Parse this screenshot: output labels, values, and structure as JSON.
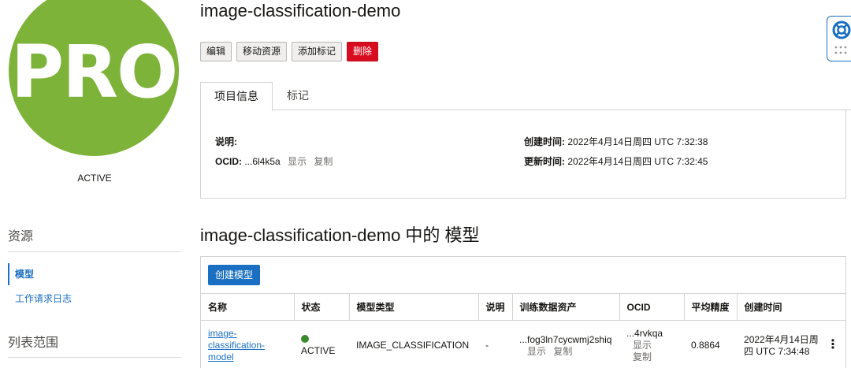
{
  "badge": {
    "text": "PRO",
    "state": "ACTIVE",
    "color": "#7eb339"
  },
  "sidebar": {
    "resources_heading": "资源",
    "nav_active": "模型",
    "nav_item": "工作请求日志",
    "list_scope_heading": "列表范围"
  },
  "header": {
    "title": "image-classification-demo",
    "buttons": {
      "edit": "编辑",
      "move": "移动资源",
      "add_tags": "添加标记",
      "delete": "删除"
    }
  },
  "tabs": {
    "project_info": "项目信息",
    "tags": "标记"
  },
  "info": {
    "description_label": "说明:",
    "ocid_label": "OCID:",
    "ocid_value": "...6l4k5a",
    "show": "显示",
    "copy": "复制",
    "created_label": "创建时间:",
    "created_value": "2022年4月14日周四 UTC 7:32:38",
    "updated_label": "更新时间:",
    "updated_value": "2022年4月14日周四 UTC 7:32:45"
  },
  "models": {
    "section_title": "image-classification-demo 中的 模型",
    "create_button": "创建模型",
    "columns": [
      "名称",
      "状态",
      "模型类型",
      "说明",
      "训练数据资产",
      "OCID",
      "平均精度",
      "创建时间"
    ],
    "rows": [
      {
        "name": "image-classification-model",
        "status": "ACTIVE",
        "type": "IMAGE_CLASSIFICATION",
        "description": "-",
        "dataset": "...fog3ln7cycwmj2shiq",
        "dataset_show": "显示",
        "dataset_copy": "复制",
        "ocid": "...4rvkqa",
        "ocid_show": "显示",
        "ocid_copy": "复制",
        "precision": "0.8864",
        "created": "2022年4月14日周四 UTC 7:34:48",
        "menu": "⋮"
      }
    ]
  },
  "colors": {
    "accent": "#1a6fc2",
    "danger": "#d70d1f",
    "active_status": "#3c8a2e"
  }
}
